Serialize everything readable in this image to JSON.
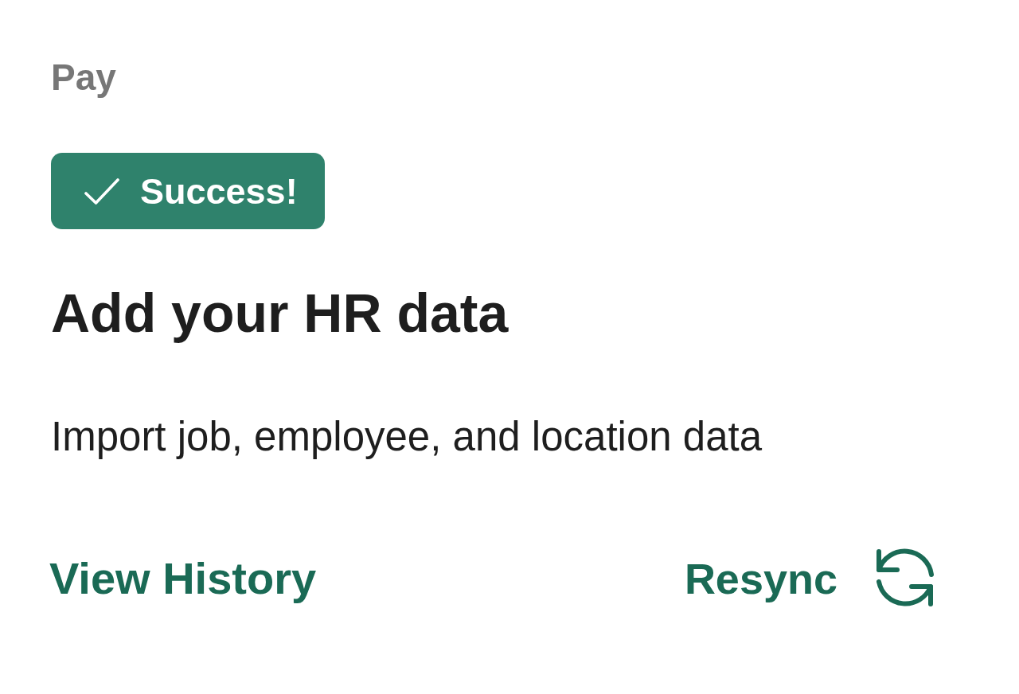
{
  "section_label": "Pay",
  "status_badge": {
    "kind": "success",
    "label": "Success!"
  },
  "title": "Add your HR data",
  "description": "Import job, employee, and location data",
  "actions": [
    {
      "kind": "link",
      "label": "View History"
    },
    {
      "kind": "icon_link",
      "label": "Resync"
    }
  ]
}
